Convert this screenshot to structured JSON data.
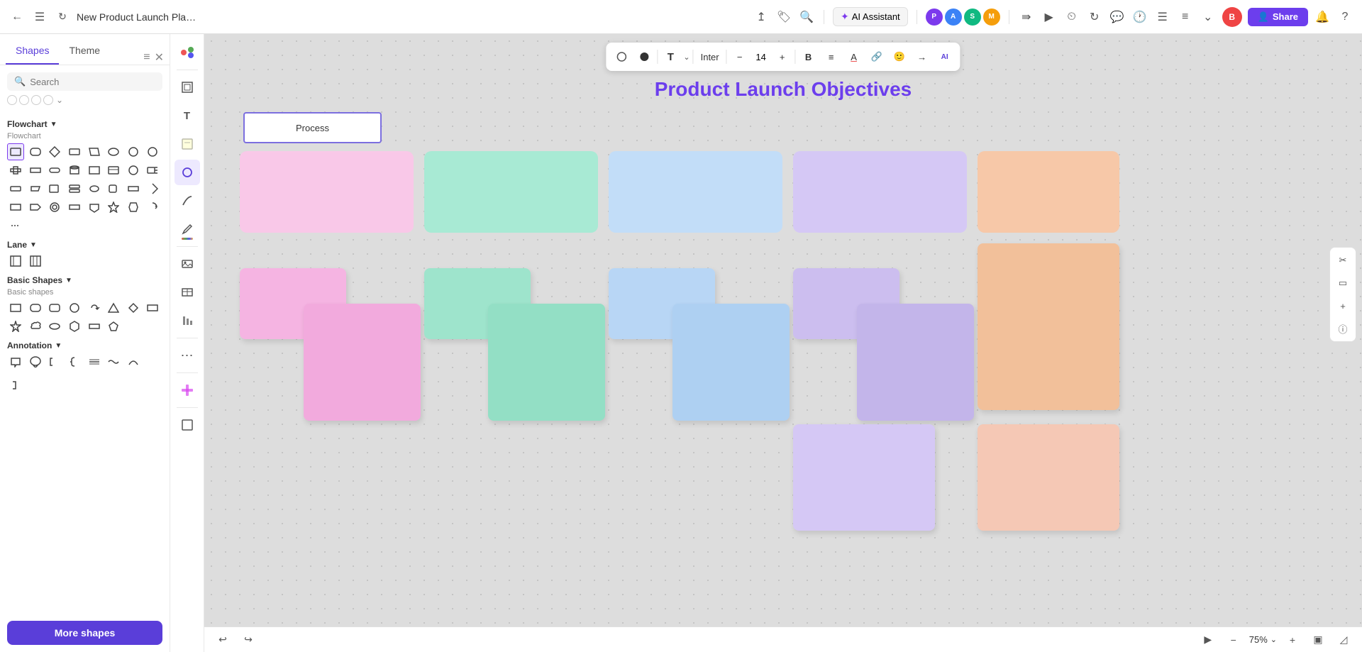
{
  "topbar": {
    "back_icon": "←",
    "menu_icon": "☰",
    "title": "New Product Launch Pla…",
    "download_icon": "⬇",
    "tag_icon": "🏷",
    "search_icon": "🔍",
    "ai_label": "AI Assistant",
    "share_label": "Share",
    "share_icon": "👤",
    "bell_icon": "🔔",
    "question_icon": "?"
  },
  "sidebar": {
    "tabs": [
      {
        "label": "Shapes",
        "active": true
      },
      {
        "label": "Theme",
        "active": false
      }
    ],
    "search_placeholder": "Search",
    "sections": {
      "flowchart": {
        "title": "Flowchart",
        "subtitle": "Flowchart"
      },
      "basic_shapes": {
        "title": "Basic Shapes",
        "subtitle": "Basic shapes"
      },
      "lane": {
        "title": "Lane"
      },
      "annotation": {
        "title": "Annotation"
      }
    },
    "more_shapes_label": "More shapes"
  },
  "canvas": {
    "page_title": "Product Launch Objectives",
    "process_label": "Process",
    "zoom_level": "75%"
  },
  "format_bar": {
    "font_family": "Inter",
    "font_size": "14",
    "bold_label": "B",
    "align_label": "≡",
    "color_label": "A"
  },
  "toolbar": {
    "tools": [
      {
        "name": "select",
        "icon": "⬡",
        "active": false
      },
      {
        "name": "frame",
        "icon": "⬜",
        "active": false
      },
      {
        "name": "text",
        "icon": "T",
        "active": false
      },
      {
        "name": "sticky",
        "icon": "🗒",
        "active": false
      },
      {
        "name": "shapes",
        "icon": "◯",
        "active": true
      },
      {
        "name": "connector",
        "icon": "∿",
        "active": false
      },
      {
        "name": "pen",
        "icon": "✏",
        "active": false
      },
      {
        "name": "image",
        "icon": "🖼",
        "active": false
      },
      {
        "name": "table",
        "icon": "⊞",
        "active": false
      },
      {
        "name": "chart",
        "icon": "📊",
        "active": false
      },
      {
        "name": "more",
        "icon": "…",
        "active": false
      },
      {
        "name": "plugin",
        "icon": "🔌",
        "active": false
      }
    ]
  }
}
